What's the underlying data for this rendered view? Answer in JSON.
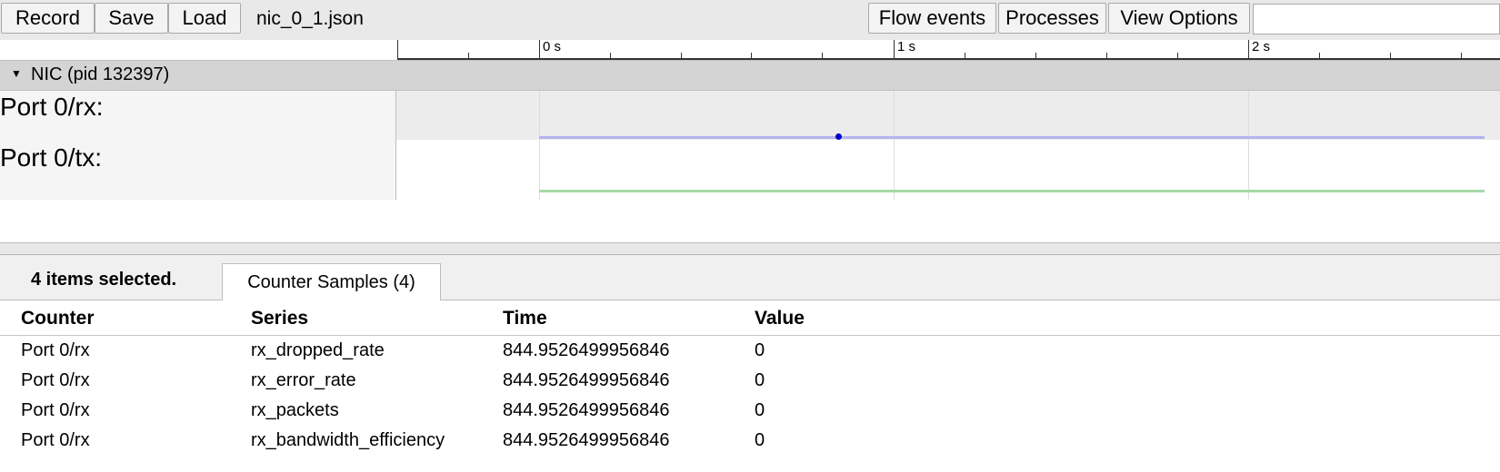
{
  "toolbar": {
    "record_label": "Record",
    "save_label": "Save",
    "load_label": "Load",
    "filename": "nic_0_1.json",
    "flow_events_label": "Flow events",
    "processes_label": "Processes",
    "view_options_label": "View Options",
    "search_value": ""
  },
  "ruler": {
    "labels": [
      "0 s",
      "1 s",
      "2 s"
    ]
  },
  "process": {
    "title": "NIC (pid 132397)",
    "expander_icon": "triangle-down-icon"
  },
  "tracks": [
    {
      "label": "Port 0/rx:",
      "color": "#b4b4f0",
      "sample_color": "#0000cc"
    },
    {
      "label": "Port 0/tx:",
      "color": "#a8d8a8"
    }
  ],
  "analysis": {
    "selection_summary": "4 items selected.",
    "tab_label": "Counter Samples (4)",
    "columns": [
      "Counter",
      "Series",
      "Time",
      "Value"
    ],
    "rows": [
      {
        "counter": "Port 0/rx",
        "series": "rx_dropped_rate",
        "time": "844.9526499956846",
        "value": "0"
      },
      {
        "counter": "Port 0/rx",
        "series": "rx_error_rate",
        "time": "844.9526499956846",
        "value": "0"
      },
      {
        "counter": "Port 0/rx",
        "series": "rx_packets",
        "time": "844.9526499956846",
        "value": "0"
      },
      {
        "counter": "Port 0/rx",
        "series": "rx_bandwidth_efficiency",
        "time": "844.9526499956846",
        "value": "0"
      }
    ]
  }
}
